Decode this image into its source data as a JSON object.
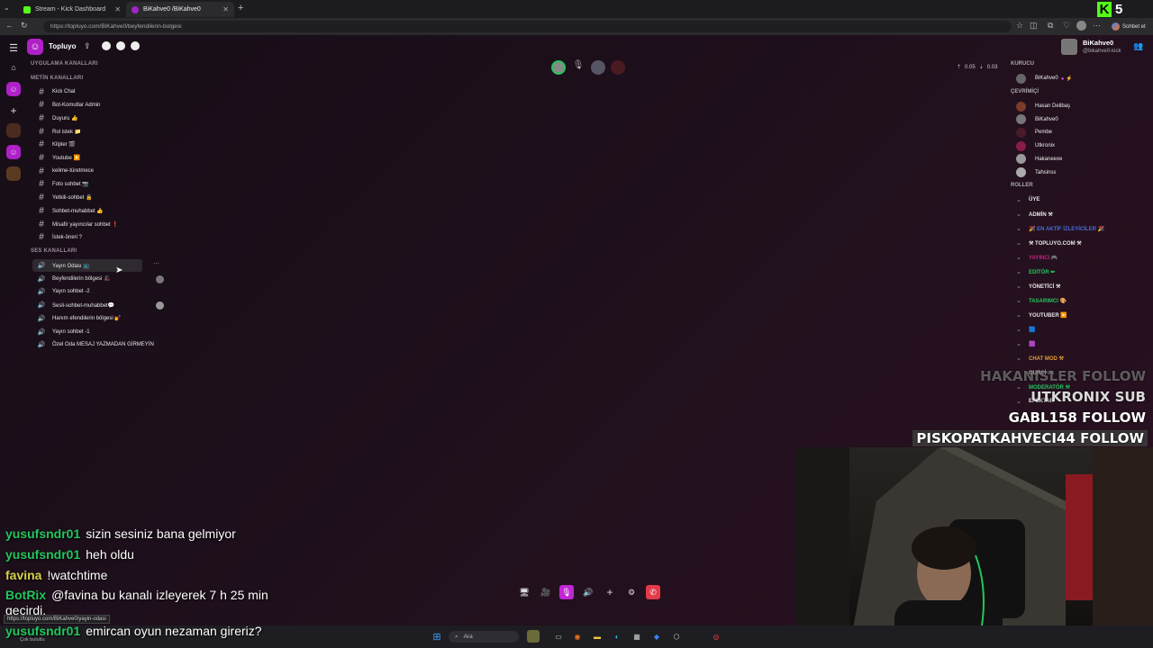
{
  "browser": {
    "tabs": [
      {
        "title": "Stream - Kick Dashboard"
      },
      {
        "title": "BiKahve0 /BiKahve0"
      }
    ],
    "url": "https://topluyo.com/BiKahve0/beyfendilerin-bolgesi",
    "profile_button": "Sohbet et",
    "hover_url": "https://topluyo.com/BiKahve0/yayin-odasi"
  },
  "kick_badge": {
    "letter": "K",
    "count": "5"
  },
  "server": {
    "name": "Topluyo"
  },
  "sections": {
    "apps": "UYGULAMA KANALLARI",
    "text": "METİN KANALLARI",
    "voice": "SES KANALLARI"
  },
  "text_channels": [
    "Kick Chat",
    "Bot-Komutlar Admin",
    "Duyuru 👍",
    "Rol istek 📁",
    "Klipler 🎬",
    "Youtube ▶️",
    "kelime-türetmece",
    "Foto sohbet 📷",
    "Yetkili-sohbet 🔒",
    "Sohbet-muhabbet 👍",
    "Misafir yayıncılar sohbet ❗",
    "İstek-öneri ?"
  ],
  "voice_channels": [
    "Yayın Odası 📺",
    "Beyfendilerin bölgesi 🎩",
    "Yayın sohbet -2",
    "Sesli-sohbet-muhabbet💬",
    "Hanım efendilerin bölgesi 💅",
    "Yayın sohbet -1",
    "Özel Oda MESAJ YAZMADAN GİRMEYİN"
  ],
  "stats": {
    "up": "0.05",
    "down": "0.03"
  },
  "user": {
    "name": "BiKahve0",
    "handle": "@bikahve0-kick"
  },
  "members": {
    "founder_label": "KURUCU",
    "founder": "BiKahve0",
    "online_label": "ÇEVRİMİÇİ",
    "online": [
      "Hasan Delibaş",
      "BiKahve0",
      "Pembe",
      "Utkronix",
      "Hakaneexe",
      "Tahsinss"
    ]
  },
  "roles": {
    "label": "ROLLER",
    "items": [
      {
        "name": "ÜYE",
        "color": "#e6e6e6"
      },
      {
        "name": "ADMİN ⚒",
        "color": "#e6e6e6"
      },
      {
        "name": "🎉 EN AKTİF İZLEYİCİLER 🎉",
        "color": "#4b6bd6"
      },
      {
        "name": "⚒ TOPLUYO.COM ⚒",
        "color": "#e6e6e6"
      },
      {
        "name": "YAYINCI 🎮",
        "color": "#c0267e"
      },
      {
        "name": "EDİTÖR ✏",
        "color": "#22c55e"
      },
      {
        "name": "YÖNETİCİ ⚒",
        "color": "#e6e6e6"
      },
      {
        "name": "TASARIMCI 🎨",
        "color": "#22c55e"
      },
      {
        "name": "YOUTUBER ▶️",
        "color": "#e6e6e6"
      },
      {
        "name": "🟦",
        "color": "#e6e6e6"
      },
      {
        "name": "🟪",
        "color": "#e6e6e6"
      },
      {
        "name": "CHAT MOD ⚒",
        "color": "#e39b3a"
      },
      {
        "name": "GURCİ 🎮",
        "color": "#e6e6e6"
      },
      {
        "name": "MODERATÖR ⚒",
        "color": "#22c55e"
      },
      {
        "name": "EFEKTAR",
        "color": "#e6e6e6"
      }
    ]
  },
  "follows": [
    {
      "name": "HAKANISLER",
      "action": "FOLLOW"
    },
    {
      "name": "UTKRONIX",
      "action": "SUB"
    },
    {
      "name": "GABL158",
      "action": "FOLLOW"
    },
    {
      "name": "PISKOPATKAHVECI44",
      "action": "FOLLOW"
    }
  ],
  "chat": [
    {
      "user": "yusufsndr01",
      "color": "#22c55e",
      "msg": "sizin sesiniz bana gelmiyor"
    },
    {
      "user": "yusufsndr01",
      "color": "#22c55e",
      "msg": "heh oldu"
    },
    {
      "user": "favina",
      "color": "#d6d24a",
      "msg": "!watchtime"
    },
    {
      "user": "BotRix",
      "color": "#22c55e",
      "msg": "@favina bu kanalı izleyerek 7 h 25 min"
    },
    {
      "user": "",
      "color": "#ffffff",
      "msg": "geçirdi."
    },
    {
      "user": "yusufsndr01",
      "color": "#22c55e",
      "msg": "emircan oyun nezaman gireriz?"
    }
  ],
  "taskbar": {
    "search": "Ara",
    "weather": "Çok bulutlu"
  }
}
